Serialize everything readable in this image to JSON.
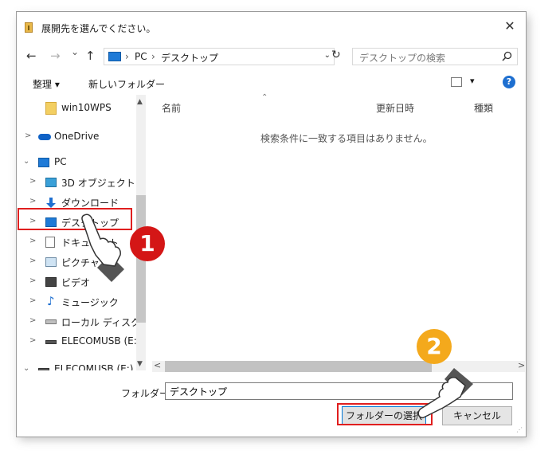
{
  "window": {
    "title": "展開先を選んでください。",
    "close": "✕"
  },
  "nav": {
    "back": "←",
    "forward": "→",
    "dropdown": "⌄",
    "up": "↑",
    "refresh": "↻"
  },
  "address": {
    "root": "PC",
    "sep1": "›",
    "sep2": "›",
    "current": "デスクトップ",
    "dropdown": "⌄"
  },
  "search": {
    "placeholder": "デスクトップの検索",
    "icon": "search-icon"
  },
  "toolbar": {
    "organize": "整理 ▾",
    "new_folder": "新しいフォルダー",
    "view_dropdown": "▾",
    "help": "?"
  },
  "sidebar": {
    "items": [
      {
        "label": "win10WPS",
        "icon": "folder-icon"
      },
      {
        "label": "OneDrive",
        "icon": "cloud-icon"
      },
      {
        "label": "PC",
        "icon": "pc-icon"
      },
      {
        "label": "3D オブジェクト",
        "icon": "3d-objects-icon"
      },
      {
        "label": "ダウンロード",
        "icon": "download-icon"
      },
      {
        "label": "デスクトップ",
        "icon": "desktop-icon"
      },
      {
        "label": "ドキュメント",
        "icon": "document-icon"
      },
      {
        "label": "ピクチャ",
        "icon": "pictures-icon"
      },
      {
        "label": "ビデオ",
        "icon": "video-icon"
      },
      {
        "label": "ミュージック",
        "icon": "music-icon"
      },
      {
        "label": "ローカル ディスク (C",
        "icon": "local-disk-icon"
      },
      {
        "label": "ELECOMUSB (E:)",
        "icon": "usb-drive-icon"
      },
      {
        "label": "ELECOMUSB (E:)",
        "icon": "usb-drive-icon"
      }
    ]
  },
  "columns": {
    "name": "名前",
    "date": "更新日時",
    "type": "種類"
  },
  "empty_message": "検索条件に一致する項目はありません。",
  "footer": {
    "folder_label": "フォルダー:",
    "folder_value": "デスクトップ",
    "select_button": "フォルダーの選択",
    "cancel_button": "キャンセル"
  },
  "annotations": {
    "step1": "1",
    "step2": "2",
    "step1_color": "#d41616",
    "step2_color": "#f4a91c",
    "highlight_color": "#e01e1e"
  },
  "colors": {
    "accent": "#1e7ad7",
    "help": "#1e6fd0"
  }
}
